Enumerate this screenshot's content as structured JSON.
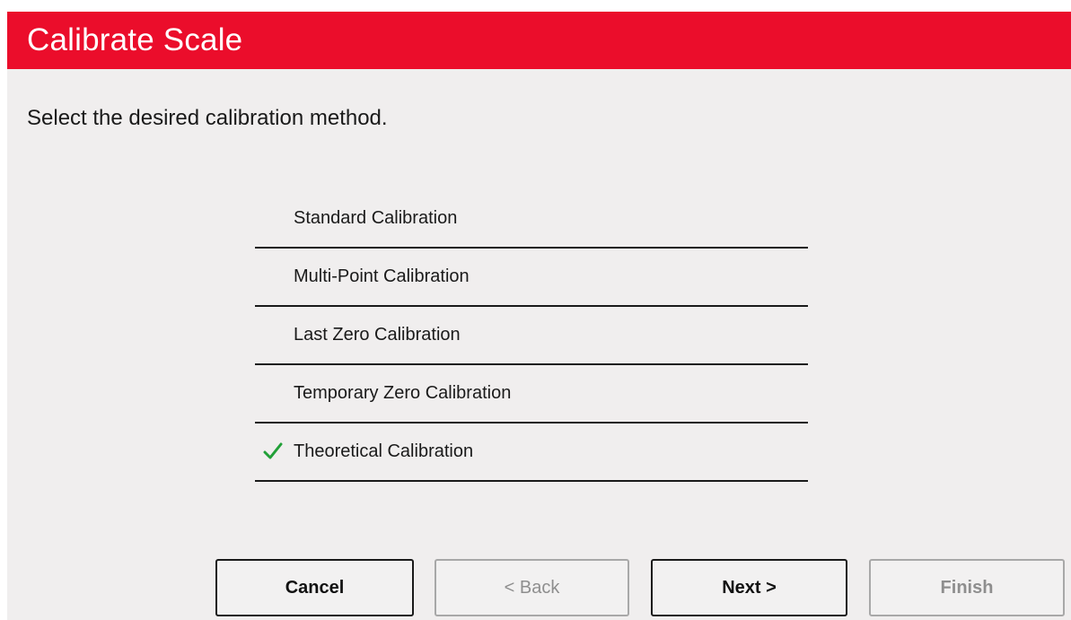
{
  "header": {
    "title": "Calibrate Scale",
    "color": "#eb0d2b"
  },
  "instruction": "Select the desired calibration method.",
  "methods": [
    {
      "label": "Standard Calibration",
      "selected": false
    },
    {
      "label": "Multi-Point Calibration",
      "selected": false
    },
    {
      "label": "Last Zero Calibration",
      "selected": false
    },
    {
      "label": "Temporary Zero Calibration",
      "selected": false
    },
    {
      "label": "Theoretical Calibration",
      "selected": true,
      "icon": "checkmark-icon",
      "icon_color": "#22a038"
    }
  ],
  "buttons": {
    "cancel": {
      "label": "Cancel",
      "enabled": true
    },
    "back": {
      "label": "< Back",
      "enabled": false
    },
    "next": {
      "label": "Next >",
      "enabled": true
    },
    "finish": {
      "label": "Finish",
      "enabled": false
    }
  }
}
